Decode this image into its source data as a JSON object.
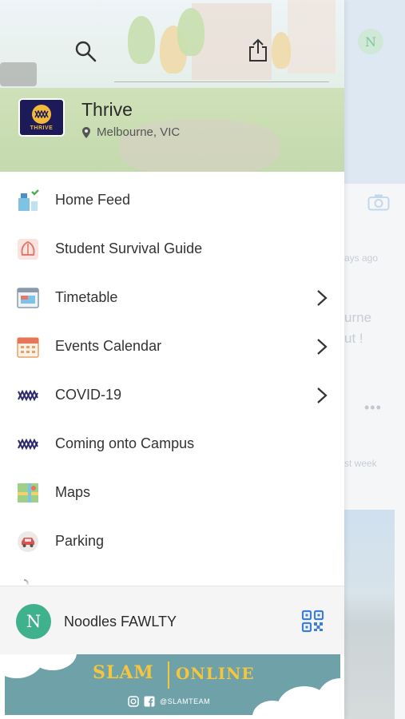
{
  "header": {
    "brand_name": "Thrive",
    "brand_logo_text": "THRIVE",
    "location": "Melbourne, VIC"
  },
  "menu": {
    "items": [
      {
        "label": "Home Feed",
        "icon": "home-feed-icon",
        "chevron": false
      },
      {
        "label": "Student Survival Guide",
        "icon": "survival-guide-icon",
        "chevron": false
      },
      {
        "label": "Timetable",
        "icon": "timetable-icon",
        "chevron": true
      },
      {
        "label": "Events Calendar",
        "icon": "calendar-icon",
        "chevron": true
      },
      {
        "label": "COVID-19",
        "icon": "thrive-mark-icon",
        "chevron": true
      },
      {
        "label": "Coming onto Campus",
        "icon": "thrive-mark-icon",
        "chevron": false
      },
      {
        "label": "Maps",
        "icon": "map-icon",
        "chevron": false
      },
      {
        "label": "Parking",
        "icon": "car-icon",
        "chevron": false
      }
    ]
  },
  "user": {
    "initial": "N",
    "name": "Noodles FAWLTY"
  },
  "banner": {
    "slam": "SLAM",
    "online": "ONLINE",
    "handle": "@SLAMTEAM"
  },
  "background": {
    "avatar_initial": "N",
    "snippets": [
      "ays ago",
      "urne",
      "ut !",
      "st week"
    ]
  },
  "colors": {
    "drawer_bg": "#ffffff",
    "user_avatar": "#3fb18d",
    "qr_accent": "#3d7fd8",
    "banner_bg": "#6fa1a8",
    "banner_text": "#f5c63c",
    "logo_bg": "#1c1a58"
  }
}
